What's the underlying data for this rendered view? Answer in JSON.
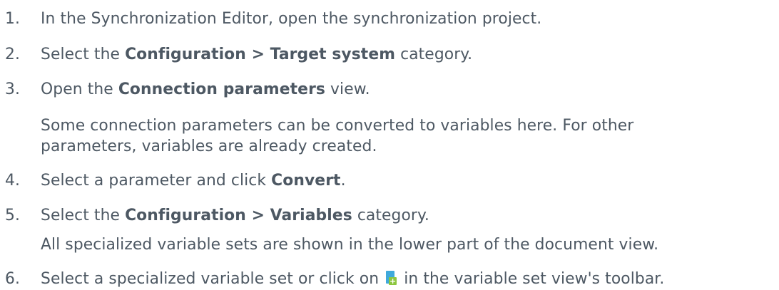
{
  "steps": [
    {
      "num": "1.",
      "pre": "In the Synchronization Editor, open the synchronization project.",
      "bold": "",
      "post": ""
    },
    {
      "num": "2.",
      "pre": "Select the ",
      "bold": "Configuration > Target system",
      "post": " category."
    },
    {
      "num": "3.",
      "pre": "Open the ",
      "bold": "Connection parameters",
      "post": " view."
    },
    {
      "num": "4.",
      "pre": "Select a parameter and click ",
      "bold": "Convert",
      "post": "."
    },
    {
      "num": "5.",
      "pre": "Select the ",
      "bold": "Configuration > Variables",
      "post": " category."
    },
    {
      "num": "6.",
      "pre": "Select a specialized variable set or click on ",
      "bold": "",
      "post": " in the variable set view's toolbar."
    }
  ],
  "notes": {
    "step3_line1": "Some connection parameters can be converted to variables here. For other",
    "step3_line2": "parameters, variables are already created.",
    "step5": "All specialized variable sets are shown in the lower part of the document view."
  },
  "icons": {
    "add_variable_set": "add-document-icon"
  },
  "colors": {
    "text": "#4d5863",
    "icon_sheet": "#3fa9db",
    "icon_plus": "#8cc63f"
  }
}
